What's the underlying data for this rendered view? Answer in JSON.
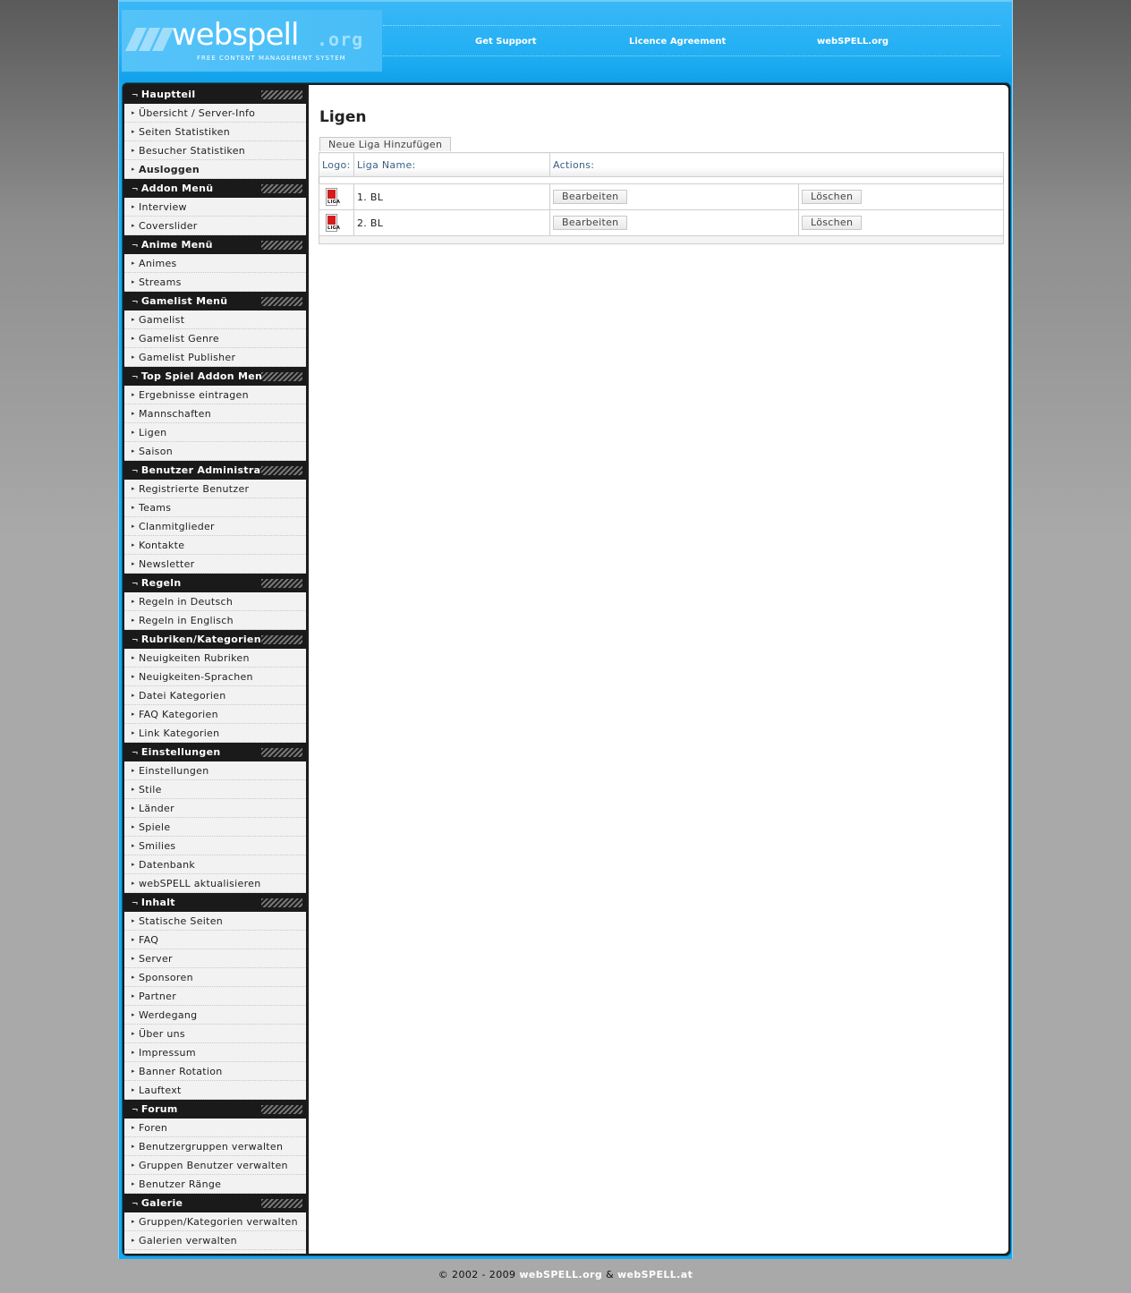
{
  "header": {
    "logo_text": "webspell",
    "logo_org": ".org",
    "logo_tagline": "FREE CONTENT MANAGEMENT SYSTEM",
    "nav": [
      "Get Support",
      "Licence Agreement",
      "webSPELL.org"
    ]
  },
  "sidebar": {
    "sections": [
      {
        "title": "Hauptteil",
        "items": [
          "Übersicht / Server-Info",
          "Seiten Statistiken",
          "Besucher Statistiken",
          "Ausloggen"
        ]
      },
      {
        "title": "Addon Menü",
        "items": [
          "Interview",
          "Coverslider"
        ]
      },
      {
        "title": "Anime Menü",
        "items": [
          "Animes",
          "Streams"
        ]
      },
      {
        "title": "Gamelist Menü",
        "items": [
          "Gamelist",
          "Gamelist Genre",
          "Gamelist Publisher"
        ]
      },
      {
        "title": "Top Spiel Addon Menü",
        "items": [
          "Ergebnisse eintragen",
          "Mannschaften",
          "Ligen",
          "Saison"
        ]
      },
      {
        "title": "Benutzer Administration",
        "items": [
          "Registrierte Benutzer",
          "Teams",
          "Clanmitglieder",
          "Kontakte",
          "Newsletter"
        ]
      },
      {
        "title": "Regeln",
        "items": [
          "Regeln in Deutsch",
          "Regeln in Englisch"
        ]
      },
      {
        "title": "Rubriken/Kategorien",
        "items": [
          "Neuigkeiten Rubriken",
          "Neuigkeiten-Sprachen",
          "Datei Kategorien",
          "FAQ Kategorien",
          "Link Kategorien"
        ]
      },
      {
        "title": "Einstellungen",
        "items": [
          "Einstellungen",
          "Stile",
          "Länder",
          "Spiele",
          "Smilies",
          "Datenbank",
          "webSPELL aktualisieren"
        ]
      },
      {
        "title": "Inhalt",
        "items": [
          "Statische Seiten",
          "FAQ",
          "Server",
          "Sponsoren",
          "Partner",
          "Werdegang",
          "Über uns",
          "Impressum",
          "Banner Rotation",
          "Lauftext"
        ]
      },
      {
        "title": "Forum",
        "items": [
          "Foren",
          "Benutzergruppen verwalten",
          "Gruppen Benutzer verwalten",
          "Benutzer Ränge"
        ]
      },
      {
        "title": "Galerie",
        "items": [
          "Gruppen/Kategorien verwalten",
          "Galerien verwalten"
        ]
      }
    ]
  },
  "main": {
    "title": "Ligen",
    "add_button": "Neue Liga Hinzufügen",
    "columns": {
      "logo": "Logo:",
      "name": "Liga Name:",
      "actions": "Actions:"
    },
    "rows": [
      {
        "logo_icon": "bundesliga-logo",
        "logo_text": "LIGA",
        "name": "1. BL",
        "edit": "Bearbeiten",
        "delete": "Löschen"
      },
      {
        "logo_icon": "bundesliga-logo",
        "logo_text": "LIGA",
        "name": "2. BL",
        "edit": "Bearbeiten",
        "delete": "Löschen"
      }
    ]
  },
  "footer": {
    "copyright": "© 2002 - 2009",
    "link1": "webSPELL.org",
    "amp": "&",
    "link2": "webSPELL.at"
  },
  "colors": {
    "header_blue": "#14a8f1",
    "sidebar_head": "#1a1a1a",
    "table_header_text": "#3a5f86",
    "liga_logo_red": "#d31d1d"
  }
}
